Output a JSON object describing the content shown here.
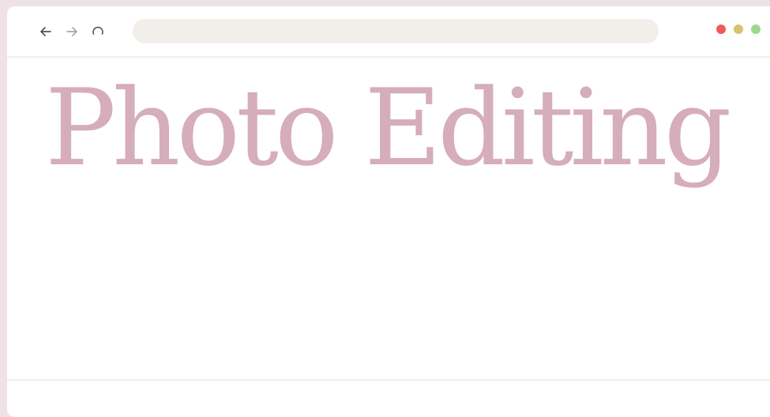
{
  "browser": {
    "address": {
      "value": "",
      "placeholder": ""
    },
    "nav_icons": {
      "back": "arrow-left-icon",
      "forward": "arrow-right-icon",
      "reload": "reload-icon"
    },
    "window_controls": {
      "close_color": "#ef5b5b",
      "minimize_color": "#d9c26b",
      "maximize_color": "#9bd98e"
    }
  },
  "page": {
    "title": "Photo Editing",
    "title_color": "#d6adba"
  }
}
